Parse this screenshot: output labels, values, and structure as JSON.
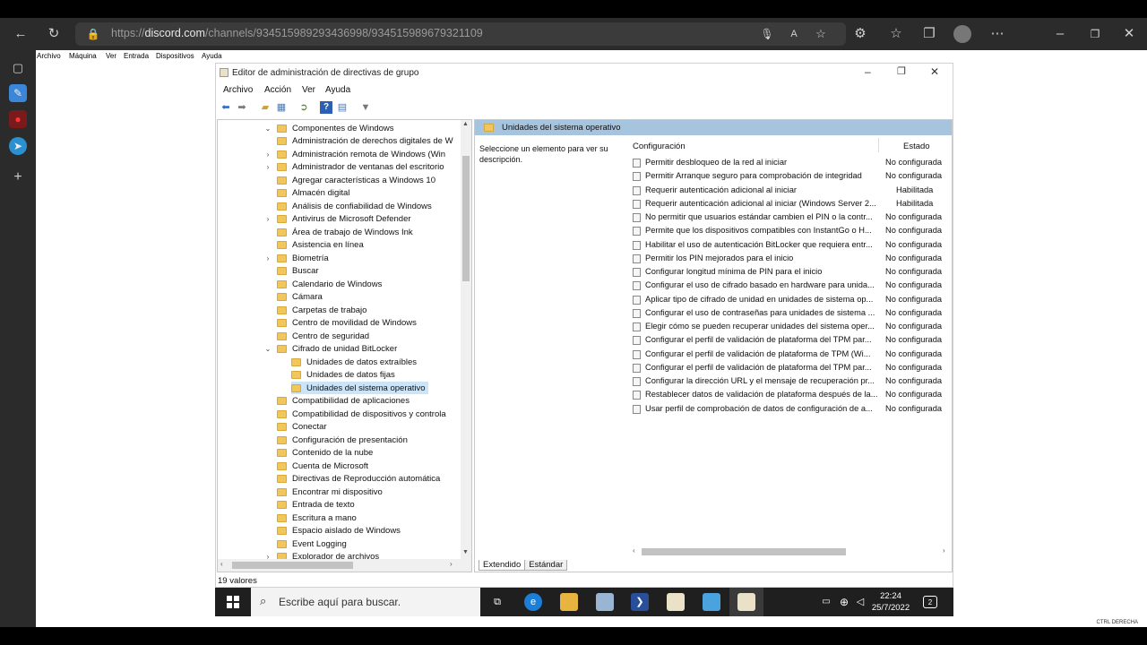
{
  "browser": {
    "url_prefix": "https://",
    "url_domain": "discord.com",
    "url_path": "/channels/934515989293436998/934515989679321109"
  },
  "vm": {
    "menu": [
      "Archivo",
      "Máquina",
      "Ver",
      "Entrada",
      "Dispositivos",
      "Ayuda"
    ],
    "status_text": "CTRL DERECHA"
  },
  "window": {
    "title": "Editor de administración de directivas de grupo",
    "menu": [
      "Archivo",
      "Acción",
      "Ver",
      "Ayuda"
    ]
  },
  "tree": {
    "items": [
      {
        "label": "Componentes de Windows",
        "arrow": "⌄"
      },
      {
        "label": "Administración de derechos digitales de W",
        "arrow": ""
      },
      {
        "label": "Administración remota de Windows (Win",
        "arrow": "›"
      },
      {
        "label": "Administrador de ventanas del escritorio",
        "arrow": "›"
      },
      {
        "label": "Agregar características a Windows 10",
        "arrow": ""
      },
      {
        "label": "Almacén digital",
        "arrow": ""
      },
      {
        "label": "Análisis de confiabilidad de Windows",
        "arrow": ""
      },
      {
        "label": "Antivirus de Microsoft Defender",
        "arrow": "›"
      },
      {
        "label": "Área de trabajo de Windows Ink",
        "arrow": ""
      },
      {
        "label": "Asistencia en línea",
        "arrow": ""
      },
      {
        "label": "Biometría",
        "arrow": "›"
      },
      {
        "label": "Buscar",
        "arrow": ""
      },
      {
        "label": "Calendario de Windows",
        "arrow": ""
      },
      {
        "label": "Cámara",
        "arrow": ""
      },
      {
        "label": "Carpetas de trabajo",
        "arrow": ""
      },
      {
        "label": "Centro de movilidad de Windows",
        "arrow": ""
      },
      {
        "label": "Centro de seguridad",
        "arrow": ""
      },
      {
        "label": "Cifrado de unidad BitLocker",
        "arrow": "⌄"
      },
      {
        "label": "Unidades de datos extraíbles",
        "arrow": ""
      },
      {
        "label": "Unidades de datos fijas",
        "arrow": ""
      },
      {
        "label": "Unidades del sistema operativo",
        "arrow": ""
      },
      {
        "label": "Compatibilidad de aplicaciones",
        "arrow": ""
      },
      {
        "label": "Compatibilidad de dispositivos y controla",
        "arrow": ""
      },
      {
        "label": "Conectar",
        "arrow": ""
      },
      {
        "label": "Configuración de presentación",
        "arrow": ""
      },
      {
        "label": "Contenido de la nube",
        "arrow": ""
      },
      {
        "label": "Cuenta de Microsoft",
        "arrow": ""
      },
      {
        "label": "Directivas de Reproducción automática",
        "arrow": ""
      },
      {
        "label": "Encontrar mi dispositivo",
        "arrow": ""
      },
      {
        "label": "Entrada de texto",
        "arrow": ""
      },
      {
        "label": "Escritura a mano",
        "arrow": ""
      },
      {
        "label": "Espacio aislado de Windows",
        "arrow": ""
      },
      {
        "label": "Event Logging",
        "arrow": ""
      },
      {
        "label": "Explorador de archivos",
        "arrow": "›"
      }
    ]
  },
  "right": {
    "header": "Unidades del sistema operativo",
    "description": "Seleccione un elemento para ver su descripción.",
    "col_config": "Configuración",
    "col_state": "Estado",
    "policies": [
      {
        "name": "Permitir desbloqueo de la red al iniciar",
        "state": "No configurada"
      },
      {
        "name": "Permitir Arranque seguro para comprobación de integridad",
        "state": "No configurada"
      },
      {
        "name": "Requerir autenticación adicional al iniciar",
        "state": "Habilitada"
      },
      {
        "name": "Requerir autenticación adicional al iniciar (Windows Server 2...",
        "state": "Habilitada"
      },
      {
        "name": "No permitir que usuarios estándar cambien el PIN o la contr...",
        "state": "No configurada"
      },
      {
        "name": "Permite que los dispositivos compatibles con InstantGo o H...",
        "state": "No configurada"
      },
      {
        "name": "Habilitar el uso de autenticación BitLocker que requiera entr...",
        "state": "No configurada"
      },
      {
        "name": "Permitir los PIN mejorados para el inicio",
        "state": "No configurada"
      },
      {
        "name": "Configurar longitud mínima de PIN para el inicio",
        "state": "No configurada"
      },
      {
        "name": "Configurar el uso de cifrado basado en hardware para unida...",
        "state": "No configurada"
      },
      {
        "name": "Aplicar tipo de cifrado de unidad en unidades de sistema op...",
        "state": "No configurada"
      },
      {
        "name": "Configurar el uso de contraseñas para unidades de sistema ...",
        "state": "No configurada"
      },
      {
        "name": "Elegir cómo se pueden recuperar unidades del sistema oper...",
        "state": "No configurada"
      },
      {
        "name": "Configurar el perfil de validación de plataforma del TPM par...",
        "state": "No configurada"
      },
      {
        "name": "Configurar el perfil de validación de plataforma de TPM (Wi...",
        "state": "No configurada"
      },
      {
        "name": "Configurar el perfil de validación de plataforma del TPM par...",
        "state": "No configurada"
      },
      {
        "name": "Configurar la dirección URL y el mensaje de recuperación pr...",
        "state": "No configurada"
      },
      {
        "name": "Restablecer datos de validación de plataforma después de la...",
        "state": "No configurada"
      },
      {
        "name": "Usar perfil de comprobación de datos de configuración de a...",
        "state": "No configurada"
      }
    ],
    "tab_extended": "Extendido",
    "tab_standard": "Estándar"
  },
  "status": "19 valores",
  "taskbar": {
    "search_placeholder": "Escribe aquí para buscar.",
    "time": "22:24",
    "date": "25/7/2022",
    "notification_count": "2"
  }
}
